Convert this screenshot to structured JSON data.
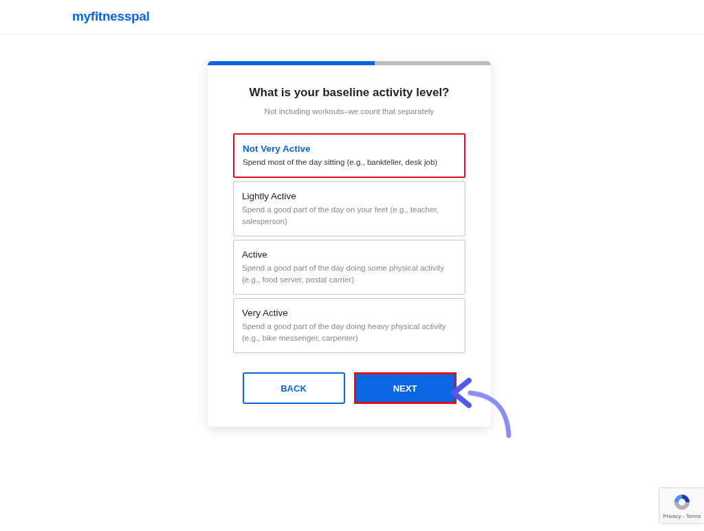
{
  "header": {
    "logo": "myfitnesspal"
  },
  "progress": {
    "level": 0.59
  },
  "question": {
    "title": "What is your baseline activity level?",
    "subtitle": "Not including workouts–we count that separately"
  },
  "options": [
    {
      "label": "Not Very Active",
      "description": "Spend most of the day sitting (e.g., bankteller, desk job)",
      "selected": true,
      "highlighted": true
    },
    {
      "label": "Lightly Active",
      "description": "Spend a good part of the day on your feet (e.g., teacher, salesperson)",
      "selected": false,
      "highlighted": false
    },
    {
      "label": "Active",
      "description": "Spend a good part of the day doing some physical activity (e.g., food server, postal carrier)",
      "selected": false,
      "highlighted": false
    },
    {
      "label": "Very Active",
      "description": "Spend a good part of the day doing heavy physical activity (e.g., bike messenger, carpenter)",
      "selected": false,
      "highlighted": false
    }
  ],
  "buttons": [
    {
      "label": "BACK",
      "kind": "secondary",
      "highlighted": false
    },
    {
      "label": "NEXT",
      "kind": "primary",
      "highlighted": true
    }
  ],
  "recaptcha": {
    "text": "Privacy - Terms"
  }
}
